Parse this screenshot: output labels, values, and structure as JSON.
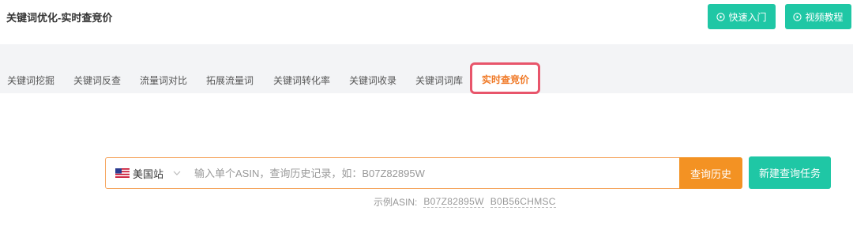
{
  "header": {
    "title": "关键词优化-实时查竞价",
    "quick_start_label": "快速入门",
    "video_tutorial_label": "视频教程"
  },
  "tabs": [
    {
      "label": "关键词挖掘",
      "active": false
    },
    {
      "label": "关键词反查",
      "active": false
    },
    {
      "label": "流量词对比",
      "active": false
    },
    {
      "label": "拓展流量词",
      "active": false
    },
    {
      "label": "关键词转化率",
      "active": false
    },
    {
      "label": "关键词收录",
      "active": false
    },
    {
      "label": "关键词词库",
      "active": false
    },
    {
      "label": "实时查竞价",
      "active": true
    }
  ],
  "search": {
    "site_label": "美国站",
    "placeholder": "输入单个ASIN，查询历史记录，如：B07Z82895W",
    "value": "",
    "history_button": "查询历史",
    "new_task_button": "新建查询任务"
  },
  "example": {
    "label": "示例ASIN:",
    "asins": [
      "B07Z82895W",
      "B0B56CHMSC"
    ]
  },
  "colors": {
    "primary_teal": "#1fc7a5",
    "accent_orange": "#f39223",
    "active_tab": "#f07a28",
    "highlight_red": "#e8556b"
  }
}
